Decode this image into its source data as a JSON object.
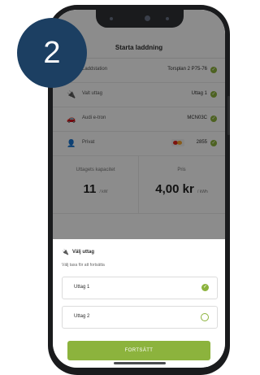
{
  "step_badge": "2",
  "app": {
    "title": "Starta laddning",
    "rows": [
      {
        "icon": "charging-station-icon",
        "label": "Laddstation",
        "value": "Torsplan 2 P75-76"
      },
      {
        "icon": "plug-icon",
        "label": "Valt uttag",
        "value": "Uttag 1"
      },
      {
        "icon": "car-icon",
        "label": "Audi e-tron",
        "value": "MCN03C"
      },
      {
        "icon": "user-icon",
        "label": "Privat",
        "value": "2855",
        "card_icon": "mastercard-icon"
      }
    ],
    "stats": {
      "capacity_label": "Uttagets kapacitet",
      "capacity_value": "11",
      "capacity_unit": "/ kW",
      "price_label": "Pris",
      "price_value": "4,00 kr",
      "price_unit": "/ kWh"
    }
  },
  "sheet": {
    "icon": "plug-icon",
    "title": "Välj uttag",
    "subtitle": "Välj taxa för att fortsätta",
    "options": [
      {
        "label": "Uttag 1",
        "selected": true
      },
      {
        "label": "Uttag 2",
        "selected": false
      }
    ],
    "cta_label": "FORTSÄTT"
  },
  "colors": {
    "accent": "#8cb33d",
    "badge": "#1c3f62",
    "phone": "#1a1b1d"
  }
}
